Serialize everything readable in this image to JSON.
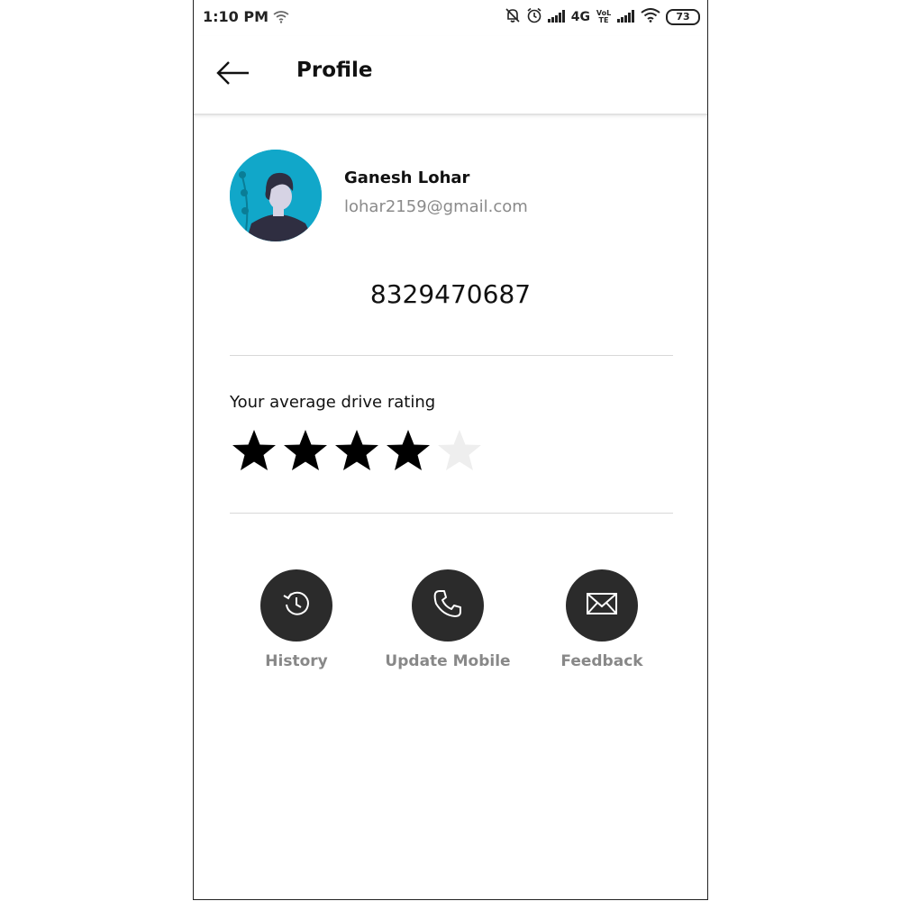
{
  "status_bar": {
    "time": "1:10 PM",
    "network": "4G",
    "volte": "VoLTE",
    "battery": "73",
    "icons": [
      "wifi-icon",
      "mute-icon",
      "alarm-icon",
      "signal-icon",
      "signal-icon",
      "wifi-icon",
      "battery-icon"
    ]
  },
  "appbar": {
    "title": "Profile",
    "back_icon": "arrow-left-icon"
  },
  "profile": {
    "name": "Ganesh Lohar",
    "email": "lohar2159@gmail.com",
    "phone": "8329470687",
    "avatar_bg": "#11a7c9"
  },
  "rating": {
    "label": "Your average drive rating",
    "value": 4,
    "max": 5,
    "filled_color": "#000000",
    "empty_color": "#eeeeee"
  },
  "actions": [
    {
      "label": "History",
      "icon": "history-icon"
    },
    {
      "label": "Update Mobile",
      "icon": "phone-icon"
    },
    {
      "label": "Feedback",
      "icon": "envelope-icon"
    }
  ],
  "colors": {
    "action_circle": "#2b2b2b",
    "muted_text": "#888888"
  }
}
